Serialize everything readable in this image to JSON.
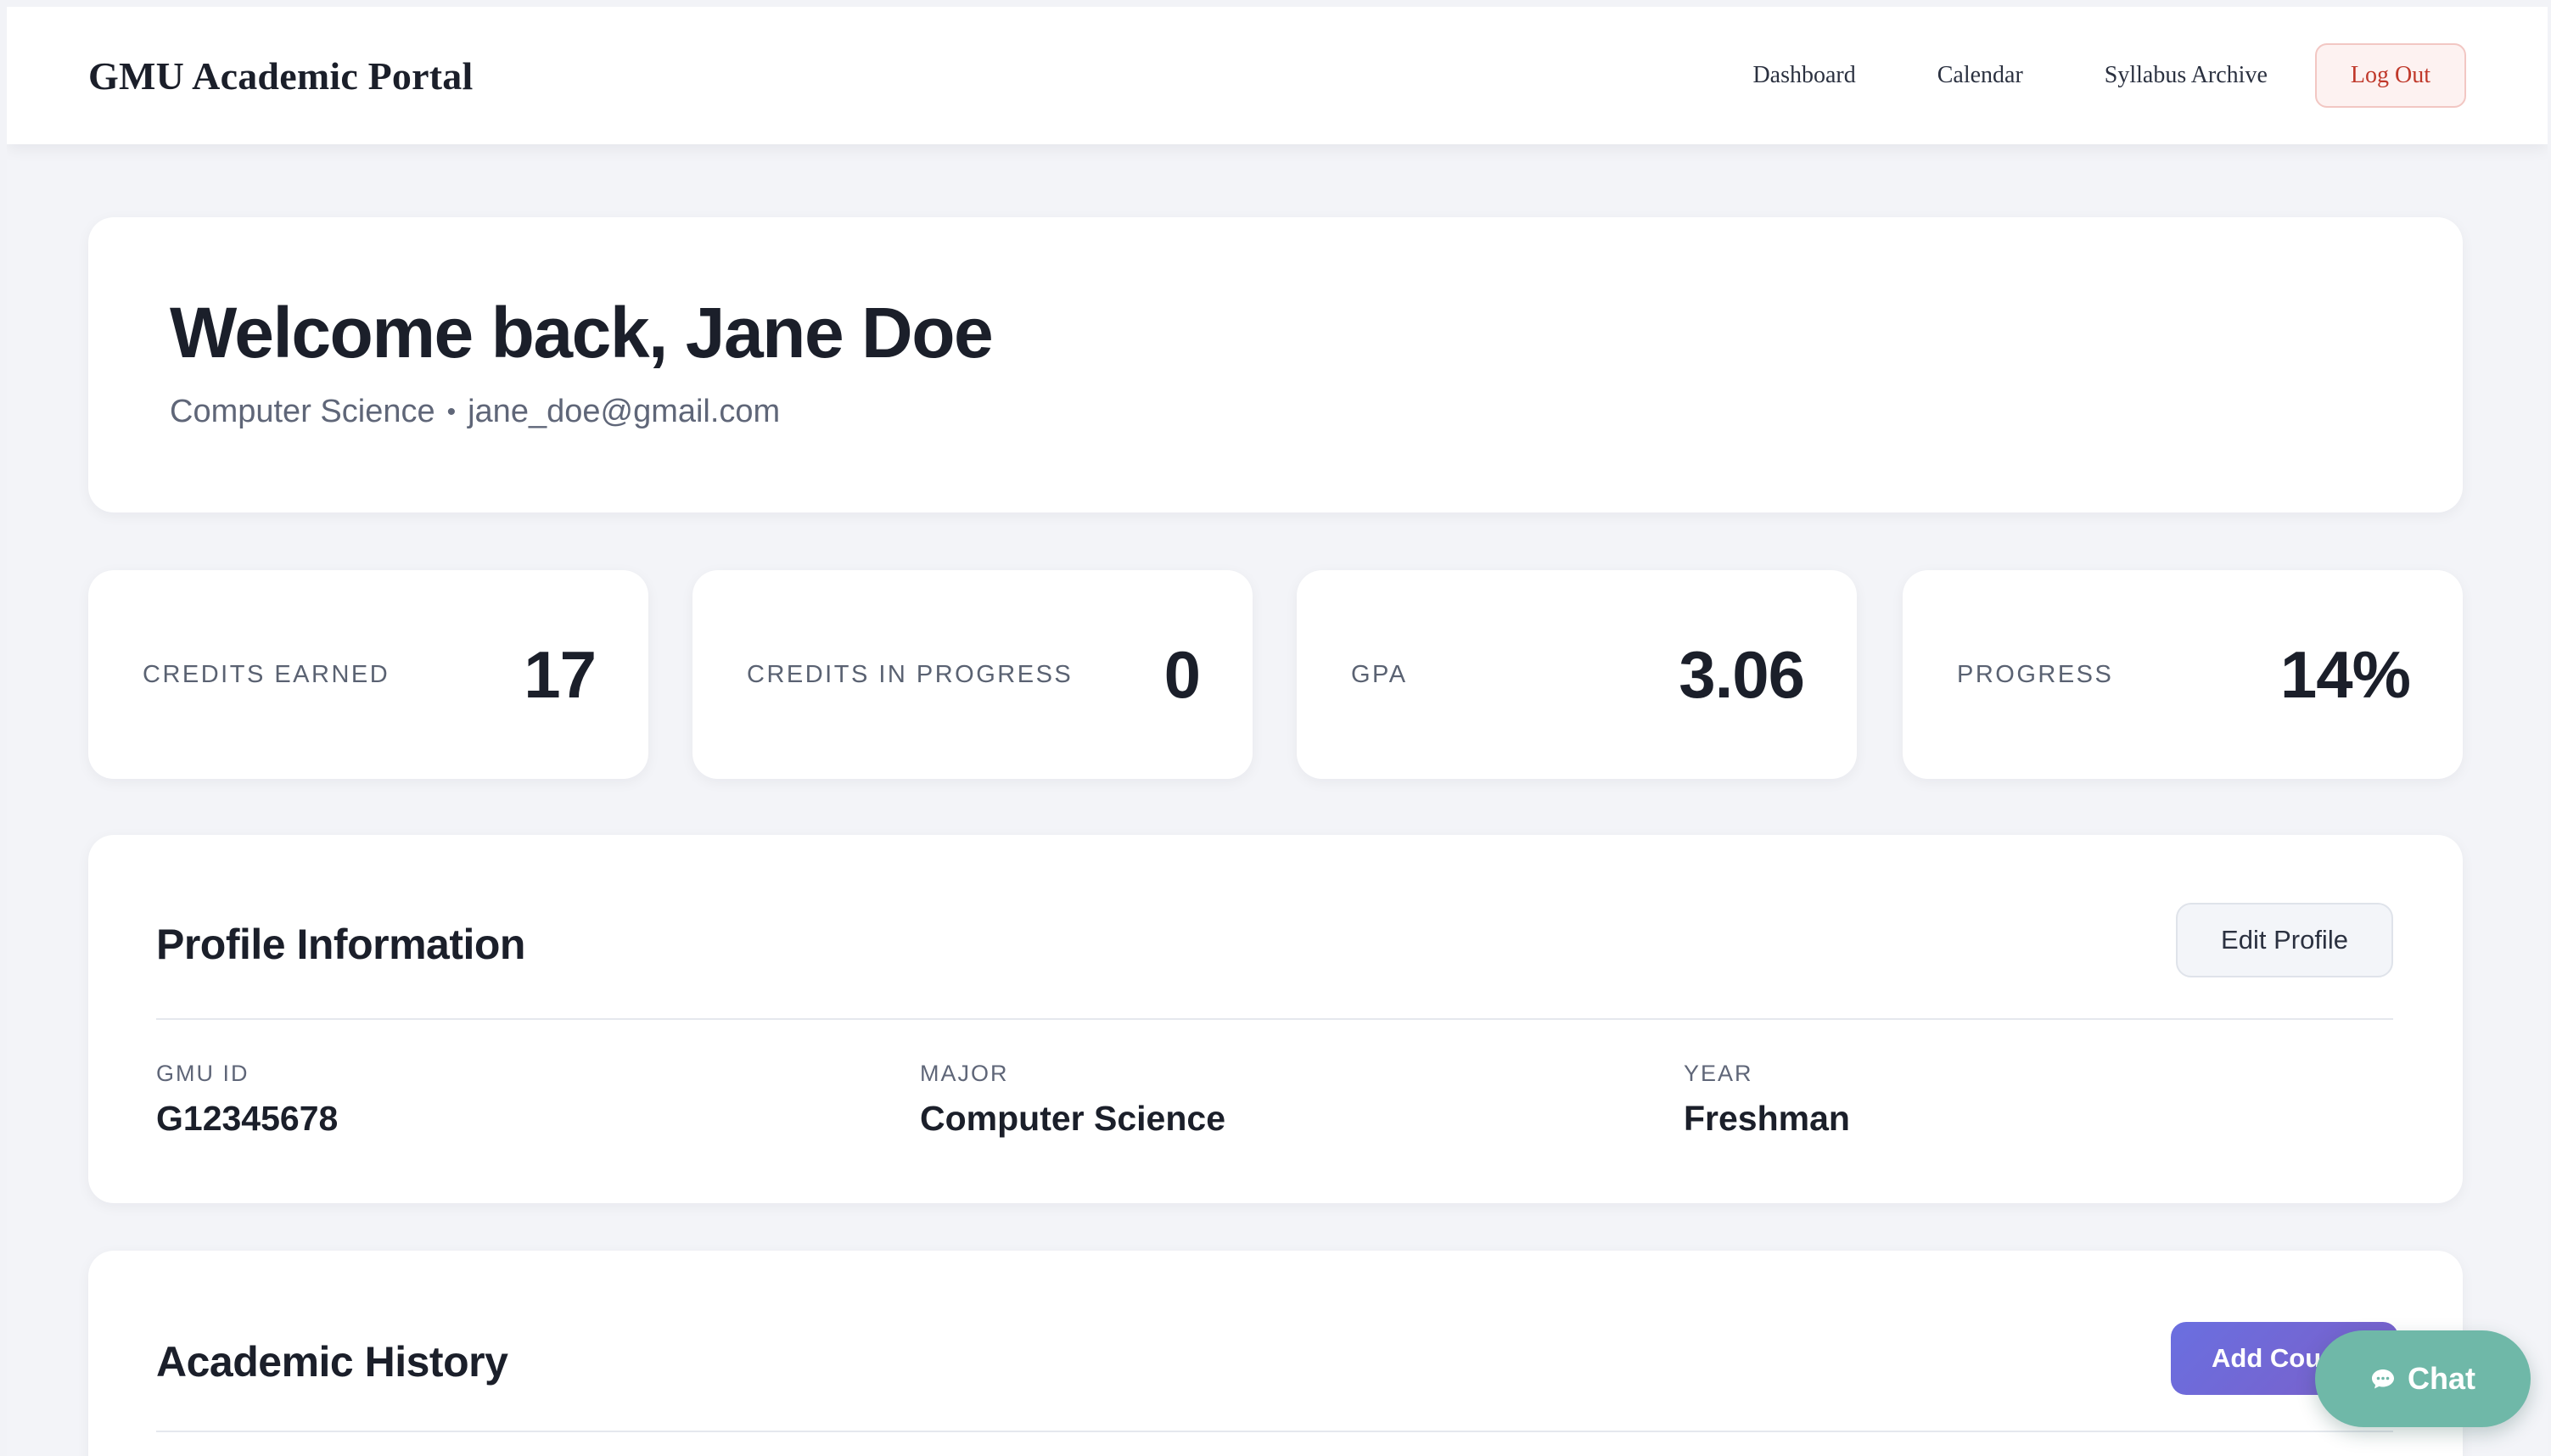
{
  "header": {
    "brand": "GMU Academic Portal",
    "nav": [
      {
        "label": "Dashboard"
      },
      {
        "label": "Calendar"
      },
      {
        "label": "Syllabus Archive"
      }
    ],
    "logout_label": "Log Out"
  },
  "welcome": {
    "title": "Welcome back, Jane Doe",
    "major": "Computer Science",
    "separator": "•",
    "email": "jane_doe@gmail.com"
  },
  "stats": [
    {
      "label": "CREDITS EARNED",
      "value": "17"
    },
    {
      "label": "CREDITS IN PROGRESS",
      "value": "0"
    },
    {
      "label": "GPA",
      "value": "3.06"
    },
    {
      "label": "PROGRESS",
      "value": "14%"
    }
  ],
  "profile": {
    "title": "Profile Information",
    "edit_label": "Edit Profile",
    "fields": [
      {
        "label": "GMU ID",
        "value": "G12345678"
      },
      {
        "label": "MAJOR",
        "value": "Computer Science"
      },
      {
        "label": "YEAR",
        "value": "Freshman"
      }
    ]
  },
  "history": {
    "title": "Academic History",
    "add_label": "Add Course"
  },
  "chat": {
    "label": "Chat",
    "icon": "chat-bubble-icon"
  },
  "colors": {
    "logout": "#c0392b",
    "accent_gradient_start": "#6a6fe0",
    "accent_gradient_end": "#7b5fc8",
    "chat": "#6fb8a8"
  }
}
